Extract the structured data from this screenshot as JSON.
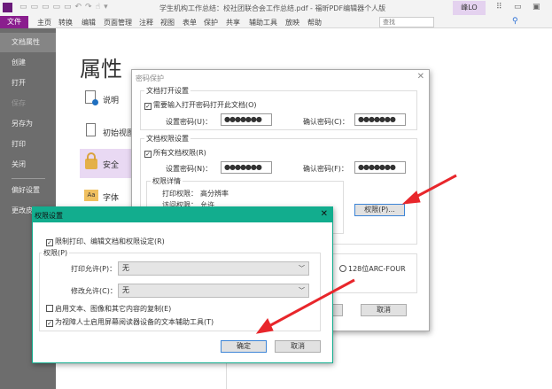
{
  "window": {
    "title": "学生机构工作总结：校社团联合会工作总结.pdf - 福昕PDF编辑器个人版",
    "user": "峰LO"
  },
  "menu": {
    "file": "文件",
    "items": [
      "主页",
      "转换",
      "编辑",
      "页面管理",
      "注释",
      "视图",
      "表单",
      "保护",
      "共享",
      "辅助工具",
      "放映",
      "帮助"
    ],
    "search_placeholder": "查找"
  },
  "sidebar": {
    "items": [
      "文档属性",
      "创建",
      "打开",
      "保存",
      "另存为",
      "打印",
      "关闭",
      "偏好设置",
      "更改皮"
    ]
  },
  "properties": {
    "title": "属性",
    "items": [
      "说明",
      "初始视图",
      "安全",
      "字体"
    ]
  },
  "password_dialog": {
    "title": "密码保护",
    "open_group": "文档打开设置",
    "open_checkbox": "需要输入打开密码打开此文档(O)",
    "set_pw_label": "设置密码(U)：",
    "confirm_pw_label": "确认密码(C)：",
    "pw_value": "●●●●●●●",
    "perm_group": "文档权限设置",
    "perm_checkbox": "所有文档权限(R)",
    "perm_set_label": "设置密码(N)：",
    "perm_confirm_label": "确认密码(F)：",
    "details_group": "权限详情",
    "print_label": "打印权限：",
    "print_value": "高分辨率",
    "access_label": "访问权限：",
    "access_value": "允许",
    "perm_button": "权限(P)...",
    "encryption_option": "128位ARC-FOUR",
    "cancel": "取消"
  },
  "perm_dialog": {
    "title": "权限设置",
    "restrict_checkbox": "限制打印、编辑文档和权限设定(R)",
    "group": "权限(P)",
    "print_label": "打印允许(P)：",
    "print_value": "无",
    "modify_label": "修改允许(C)：",
    "modify_value": "无",
    "copy_checkbox": "启用文本、图像和其它内容的复制(E)",
    "access_checkbox": "为视障人士启用屏幕阅读器设备的文本辅助工具(T)",
    "ok": "确定",
    "cancel": "取消"
  },
  "colors": {
    "accent": "#8a1e8e",
    "dialog_title": "#12ad8e",
    "arrow": "#e8262b",
    "highlight": "#e9d9f3"
  }
}
